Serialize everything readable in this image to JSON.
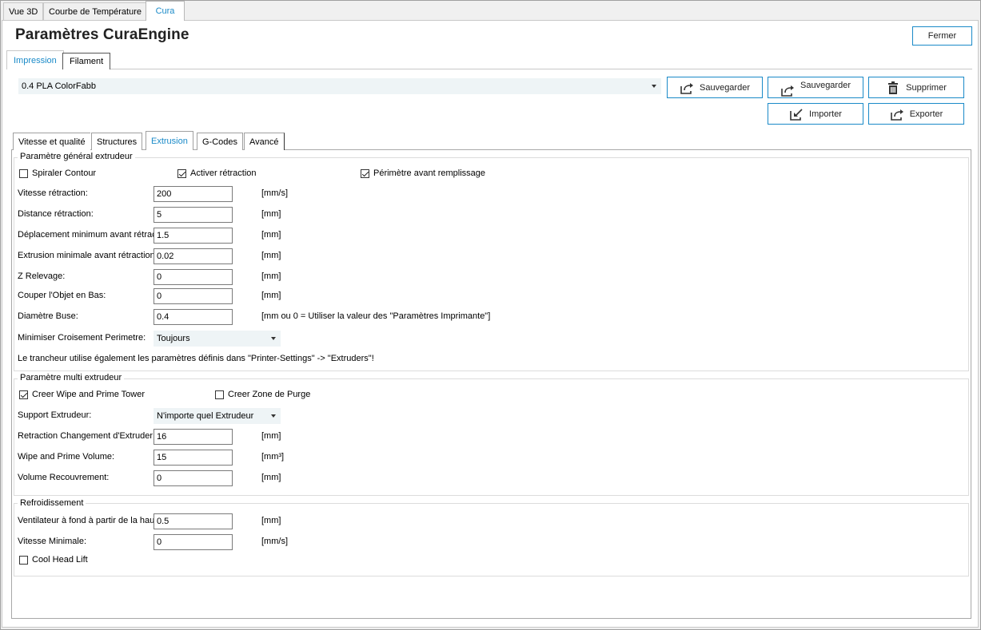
{
  "top_tabs": [
    "Vue 3D",
    "Courbe de Température",
    "Cura"
  ],
  "title": "Paramètres CuraEngine",
  "close_button": "Fermer",
  "section_tabs": [
    "Impression",
    "Filament"
  ],
  "profile": {
    "selected": "0.4 PLA ColorFabb",
    "save_as_label": "Sauvegarder",
    "save_label": "Sauvegarder",
    "delete_label": "Supprimer",
    "import_label": "Importer",
    "export_label": "Exporter"
  },
  "sub_tabs": [
    "Vitesse et qualité",
    "Structures",
    "Extrusion",
    "G-Codes",
    "Avancé"
  ],
  "general": {
    "title": "Paramètre général extrudeur",
    "spiral_label": "Spiraler Contour",
    "enable_retraction_label": "Activer rétraction",
    "perimeter_before_infill_label": "Périmètre avant remplissage",
    "rows": [
      {
        "label": "Vitesse rétraction:",
        "value": "200",
        "unit": "[mm/s]"
      },
      {
        "label": "Distance rétraction:",
        "value": "5",
        "unit": "[mm]"
      },
      {
        "label": "Déplacement minimum avant rétraction:",
        "value": "1.5",
        "unit": "[mm]"
      },
      {
        "label": "Extrusion minimale avant rétraction:",
        "value": "0.02",
        "unit": "[mm]"
      },
      {
        "label": "Z Relevage:",
        "value": "0",
        "unit": "[mm]"
      },
      {
        "label": "Couper l'Objet en Bas:",
        "value": "0",
        "unit": "[mm]"
      },
      {
        "label": "Diamètre Buse:",
        "value": "0.4",
        "unit": "[mm ou 0 = Utiliser la valeur des \"Paramètres Imprimante\"]"
      }
    ],
    "minimize_crossing_label": "Minimiser Croisement Perimetre:",
    "minimize_crossing_value": "Toujours",
    "note": "Le trancheur utilise également les paramètres définis dans \"Printer-Settings\" -> \"Extruders\"!"
  },
  "multi": {
    "title": "Paramètre multi extrudeur",
    "wipe_tower_label": "Creer Wipe and Prime Tower",
    "purge_zone_label": "Creer Zone de Purge",
    "support_extruder_label": "Support Extrudeur:",
    "support_extruder_value": "N'importe quel Extrudeur",
    "rows": [
      {
        "label": "Retraction Changement d'Extruder:",
        "value": "16",
        "unit": "[mm]"
      },
      {
        "label": "Wipe and Prime Volume:",
        "value": "15",
        "unit": "[mm³]"
      },
      {
        "label": "Volume Recouvrement:",
        "value": "0",
        "unit": "[mm]"
      }
    ]
  },
  "cooling": {
    "title": "Refroidissement",
    "rows": [
      {
        "label": "Ventilateur à fond à partir de la hauteur:",
        "value": "0.5",
        "unit": "[mm]"
      },
      {
        "label": "Vitesse Minimale:",
        "value": "0",
        "unit": "[mm/s]"
      }
    ],
    "cool_head_lift_label": "Cool Head Lift"
  }
}
